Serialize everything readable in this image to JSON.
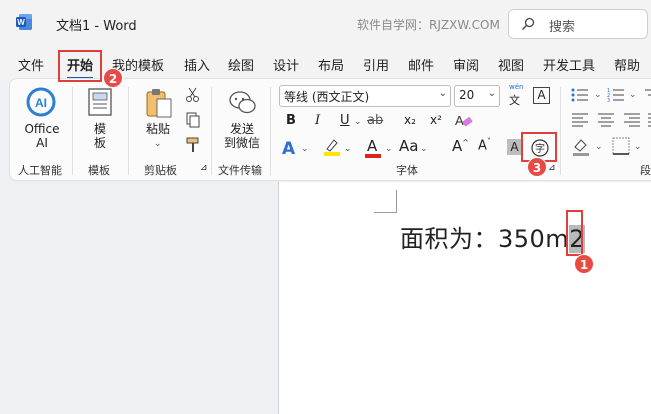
{
  "titlebar": {
    "doc_name": "文档1  -  Word",
    "watermark": "软件自学网：RJZXW.COM",
    "search_label": "搜索"
  },
  "tabs": [
    {
      "label": "文件"
    },
    {
      "label": "开始"
    },
    {
      "label": "我的模板"
    },
    {
      "label": "插入"
    },
    {
      "label": "绘图"
    },
    {
      "label": "设计"
    },
    {
      "label": "布局"
    },
    {
      "label": "引用"
    },
    {
      "label": "邮件"
    },
    {
      "label": "审阅"
    },
    {
      "label": "视图"
    },
    {
      "label": "开发工具"
    },
    {
      "label": "帮助"
    }
  ],
  "active_tab": "开始",
  "ribbon": {
    "office_ai": {
      "line1": "Office",
      "line2": "AI",
      "group": "人工智能"
    },
    "template": {
      "line1": "模",
      "line2": "板",
      "group": "模板"
    },
    "clipboard": {
      "paste": "粘贴",
      "group": "剪贴板"
    },
    "transfer": {
      "line1": "发送",
      "line2": "到微信",
      "group": "文件传输"
    },
    "font": {
      "font_name": "等线 (西文正文)",
      "font_size": "20",
      "group": "字体",
      "bold": "B",
      "italic": "I",
      "underline": "U",
      "strike": "ab",
      "subscript": "x₂",
      "superscript": "x²",
      "grow": "A^",
      "shrink": "A˅",
      "wen_top": "wén",
      "wen_bottom": "文",
      "phonetic_char": "字",
      "char_shade": "A",
      "char_border": "A"
    },
    "paragraph": {
      "group": "段"
    }
  },
  "document": {
    "text_main": "面积为：350m",
    "text_selected": "2"
  },
  "callouts": [
    {
      "number": "1"
    },
    {
      "number": "2"
    },
    {
      "number": "3"
    }
  ],
  "colors": {
    "accent": "#185abd",
    "callout_red": "#e84a44",
    "highlight_yellow": "#ffe600",
    "font_red": "#e0201a"
  }
}
